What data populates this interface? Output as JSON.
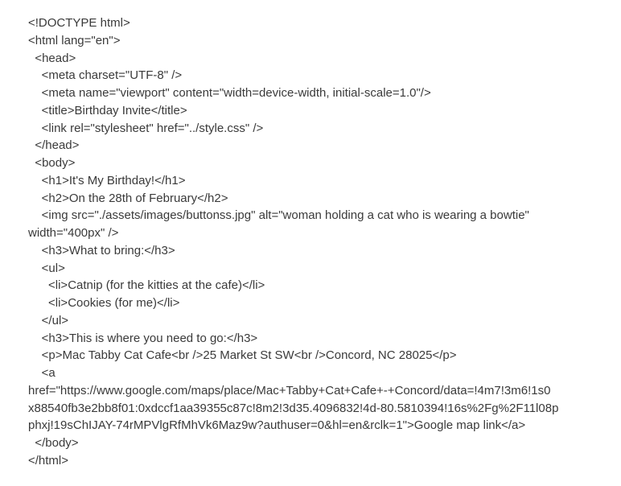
{
  "document": {
    "lines": [
      "<!DOCTYPE html>",
      "<html lang=\"en\">",
      "  <head>",
      "    <meta charset=\"UTF-8\" />",
      "    <meta name=\"viewport\" content=\"width=device-width, initial-scale=1.0\"/>",
      "    <title>Birthday Invite</title>",
      "    <link rel=\"stylesheet\" href=\"../style.css\" />",
      "  </head>",
      "  <body>",
      "    <h1>It's My Birthday!</h1>",
      "    <h2>On the 28th of February</h2>",
      "    <img src=\"./assets/images/buttonss.jpg\" alt=\"woman holding a cat who is wearing a bowtie\"",
      "width=\"400px\" />",
      "    <h3>What to bring:</h3>",
      "    <ul>",
      "      <li>Catnip (for the kitties at the cafe)</li>",
      "      <li>Cookies (for me)</li>",
      "    </ul>",
      "    <h3>This is where you need to go:</h3>",
      "    <p>Mac Tabby Cat Cafe<br />25 Market St SW<br />Concord, NC 28025</p>",
      "    <a",
      "href=\"https://www.google.com/maps/place/Mac+Tabby+Cat+Cafe+-+Concord/data=!4m7!3m6!1s0",
      "x88540fb3e2bb8f01:0xdccf1aa39355c87c!8m2!3d35.4096832!4d-80.5810394!16s%2Fg%2F11l08p",
      "phxj!19sChIJAY-74rMPVlgRfMhVk6Maz9w?authuser=0&hl=en&rclk=1\">Google map link</a>",
      "  </body>",
      "</html>"
    ]
  }
}
